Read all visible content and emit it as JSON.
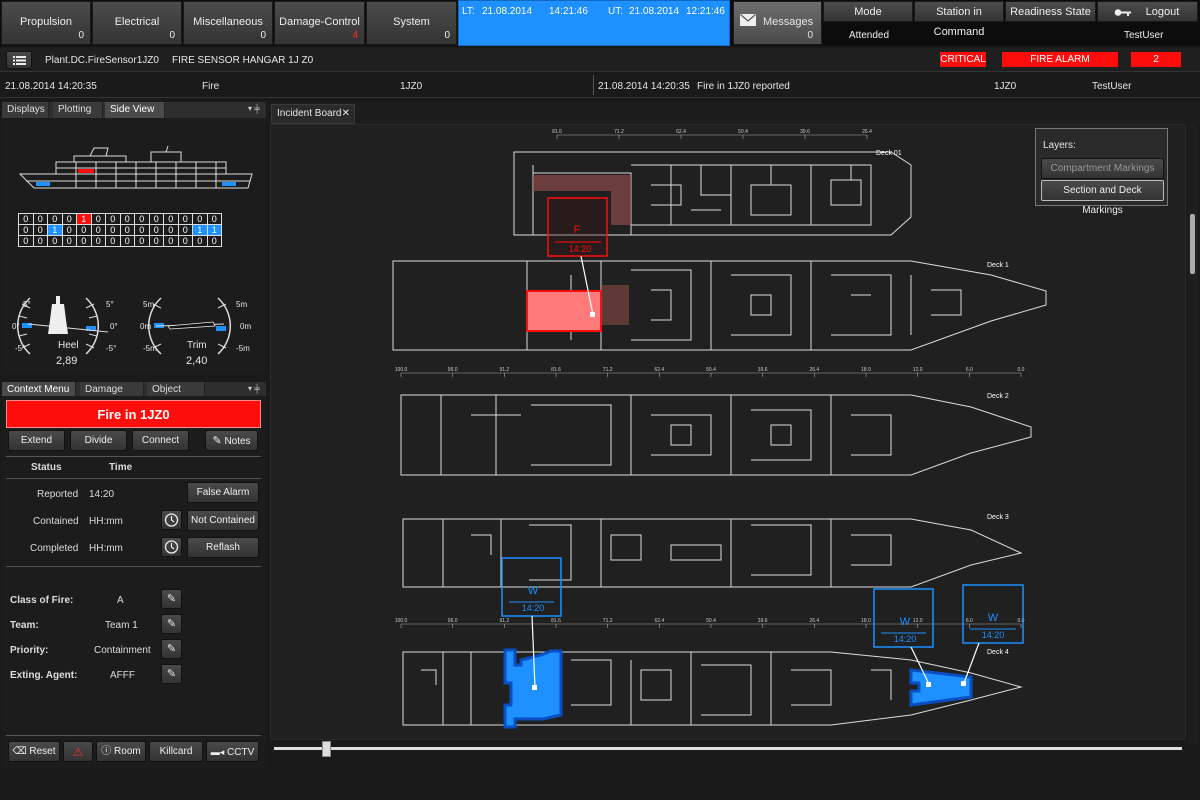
{
  "top_bar": {
    "systems": [
      {
        "label": "Propulsion",
        "count": "0"
      },
      {
        "label": "Electrical",
        "count": "0"
      },
      {
        "label": "Miscellaneous",
        "count": "0"
      },
      {
        "label": "Damage-Control",
        "count": "4"
      },
      {
        "label": "System",
        "count": "0"
      }
    ],
    "lt_label": "LT:",
    "lt_date": "21.08.2014",
    "lt_time": "14:21:46",
    "ut_label": "UT:",
    "ut_date": "21.08.2014",
    "ut_time": "12:21:46",
    "messages_label": "Messages",
    "messages_count": "0",
    "mode_label": "Mode",
    "mode_value": "Attended",
    "station_label": "Station in Command",
    "readiness_label": "Readiness State",
    "logout_label": "Logout",
    "user": "TestUser"
  },
  "alarm_bar": {
    "path": "Plant.DC.FireSensor1JZ0",
    "description": "FIRE SENSOR HANGAR 1J Z0",
    "severity": "CRITICAL",
    "alarm": "FIRE ALARM",
    "count": "2"
  },
  "event_row": {
    "left_time": "21.08.2014 14:20:35",
    "left_type": "Fire",
    "left_code": "1JZ0",
    "right_time": "21.08.2014 14:20:35",
    "right_msg": "Fire in 1JZ0 reported",
    "right_code": "1JZ0",
    "right_user": "TestUser"
  },
  "left_top_tabs": [
    "Displays",
    "Plotting",
    "Side View"
  ],
  "status_grid": [
    [
      "0",
      "0",
      "0",
      "0",
      "1",
      "0",
      "0",
      "0",
      "0",
      "0",
      "0",
      "0",
      "0",
      "0"
    ],
    [
      "0",
      "0",
      "1",
      "0",
      "0",
      "0",
      "0",
      "0",
      "0",
      "0",
      "0",
      "0",
      "1",
      "1"
    ],
    [
      "0",
      "0",
      "0",
      "0",
      "0",
      "0",
      "0",
      "0",
      "0",
      "0",
      "0",
      "0",
      "0",
      "0"
    ]
  ],
  "gauges": {
    "heel_label": "Heel",
    "heel_value": "2,89",
    "heel_ticks": [
      "5°",
      "0°",
      "-5°",
      "5°",
      "0°",
      "-5°"
    ],
    "trim_label": "Trim",
    "trim_value": "2,40",
    "trim_ticks": [
      "5m",
      "0m",
      "-5m",
      "5m",
      "0m",
      "-5m"
    ]
  },
  "left_bottom_tabs": [
    "Context Menu",
    "Damage List",
    "Object List"
  ],
  "incident": {
    "title": "Fire in 1JZ0",
    "actions": [
      "Extend",
      "Divide",
      "Connect",
      "Notes"
    ],
    "status_header": "Status",
    "time_header": "Time",
    "reported_label": "Reported",
    "reported_time": "14:20",
    "false_alarm": "False Alarm",
    "contained_label": "Contained",
    "contained_time": "HH:mm",
    "not_contained": "Not Contained",
    "completed_label": "Completed",
    "completed_time": "HH:mm",
    "reflash": "Reflash",
    "class_label": "Class of Fire:",
    "class_value": "A",
    "team_label": "Team:",
    "team_value": "Team 1",
    "priority_label": "Priority:",
    "priority_value": "Containment",
    "agent_label": "Exting. Agent:",
    "agent_value": "AFFF",
    "bottom_buttons": [
      "Reset",
      "Room",
      "Killcard",
      "CCTV"
    ]
  },
  "board": {
    "tab": "Incident Board",
    "layers_title": "Layers:",
    "layer_compartment": "Compartment Markings",
    "layer_section": "Section and Deck Markings",
    "decks": [
      "Deck 01",
      "Deck 1",
      "Deck 2",
      "Deck 3",
      "Deck 4"
    ],
    "fire_marker_letter": "F",
    "fire_marker_time": "14:20",
    "water_markers": [
      {
        "letter": "W",
        "time": "14:20"
      },
      {
        "letter": "W",
        "time": "14:20"
      },
      {
        "letter": "W",
        "time": "14:20"
      }
    ],
    "frame_top": [
      "81.6",
      "71.2",
      "62.4",
      "50.4",
      "39.6",
      "26.4"
    ],
    "frame_mid": [
      "100.0",
      "96.0",
      "91.2",
      "81.6",
      "71.2",
      "62.4",
      "50.4",
      "39.6",
      "26.4",
      "18.0",
      "12.0",
      "6.0",
      "0.0"
    ],
    "frame_low": [
      "100.0",
      "96.0",
      "91.2",
      "81.6",
      "71.2",
      "62.4",
      "50.4",
      "39.6",
      "26.4",
      "18.0",
      "12.0",
      "6.0",
      "0.0"
    ]
  },
  "colors": {
    "alarm_red": "#ff0c0c",
    "water_blue": "#1e90ff",
    "fire_fill": "#ff7a7a"
  }
}
